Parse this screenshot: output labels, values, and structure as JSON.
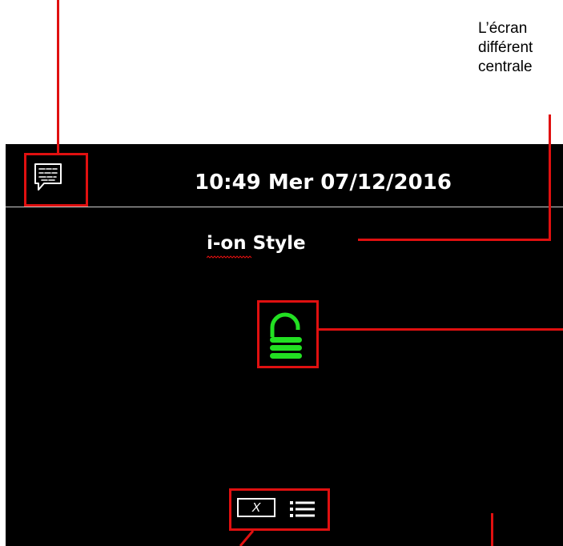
{
  "annotation": {
    "lines": [
      "L’écran",
      "différent",
      "centrale"
    ]
  },
  "screen": {
    "datetime": "10:49 Mer 07/12/2016",
    "panel_name": "i-on Style",
    "lock_color": "#22e022",
    "icons": {
      "messages": "speech-bubble-icon",
      "lock": "unlocked-padlock-icon",
      "cancel": "cancel-x-icon",
      "menu": "menu-list-icon"
    },
    "cancel_label": "X"
  },
  "colors": {
    "screen_background": "#000000",
    "annotation_red": "#e01010",
    "text": "#ffffff"
  }
}
